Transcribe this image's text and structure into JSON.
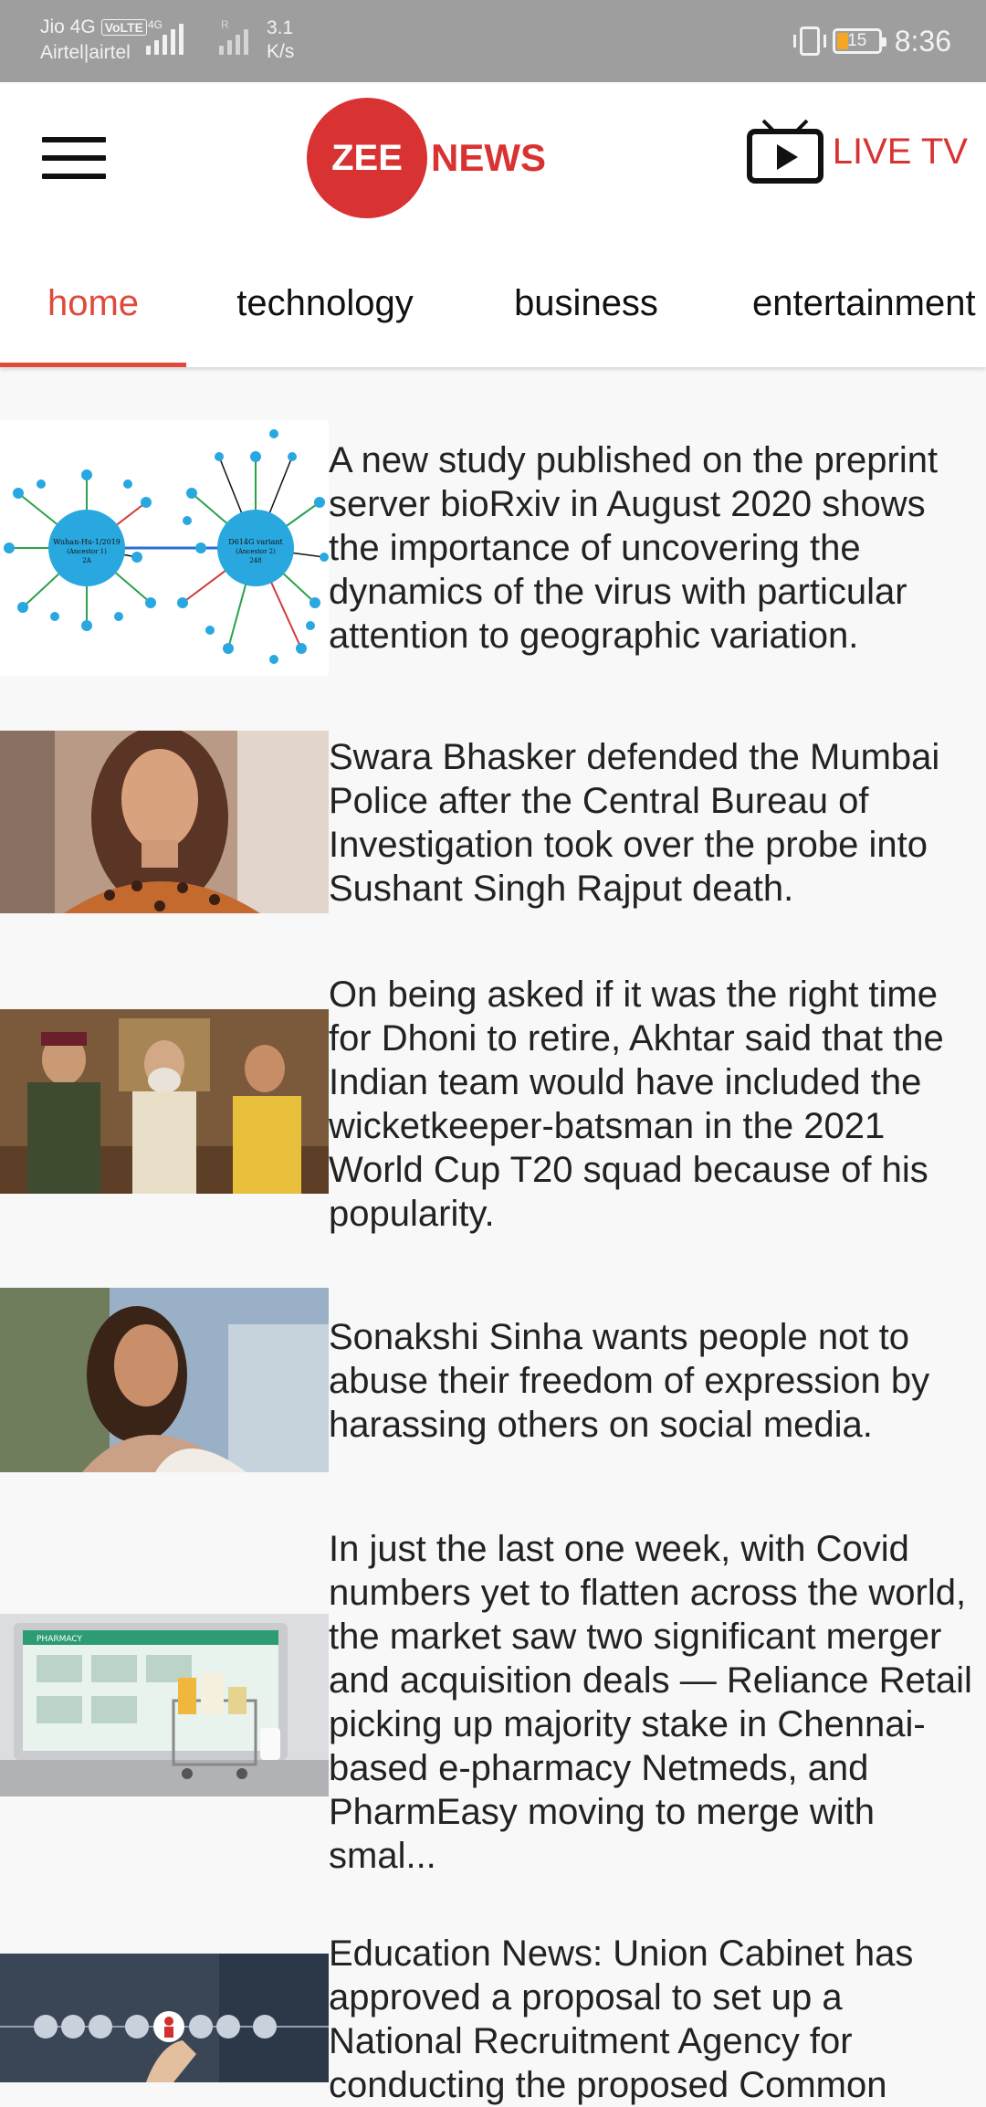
{
  "status_bar": {
    "carrier_line1": "Jio 4G",
    "volte": "VoLTE",
    "carrier_line2": "Airtel|airtel",
    "net_4g": "4G",
    "net_r": "R",
    "speed_value": "3.1",
    "speed_unit": "K/s",
    "battery_level": "15",
    "time": "8:36"
  },
  "header": {
    "logo_left": "ZEE",
    "logo_right": "NEWS",
    "live_tv_label": "LIVE TV",
    "accent_color": "#d93232"
  },
  "tabs": [
    {
      "label": "home",
      "active": true
    },
    {
      "label": "technology",
      "active": false
    },
    {
      "label": "business",
      "active": false
    },
    {
      "label": "entertainment",
      "active": false
    }
  ],
  "news": [
    {
      "headline": "A new study published on the preprint server bioRxiv in August 2020 shows the importance of uncovering the dynamics of the virus with particular attention to geographic variation.",
      "image": "virus-network-diagram",
      "diagram_labels": {
        "left": "Wuhan-Hu-1/2019",
        "left_sub": "(Ancestor 1)",
        "left_num": "2A",
        "right": "D614G variant",
        "right_sub": "(Ancestor 2)",
        "right_num": "248"
      }
    },
    {
      "headline": "Swara Bhasker defended the Mumbai Police after the Central Bureau of Investigation took over the probe into Sushant Singh Rajput death.",
      "image": "portrait-woman-polka-dot"
    },
    {
      "headline": "On being asked if it was the right time for Dhoni to retire, Akhtar said that the Indian team would have included the wicketkeeper-batsman in the 2021 World Cup T20 squad because of his popularity.",
      "image": "group-photo-three-people"
    },
    {
      "headline": "Sonakshi Sinha wants people not to abuse their freedom of expression by harassing others on social media.",
      "image": "portrait-woman-outdoor"
    },
    {
      "headline": "In just the last one week, with Covid numbers yet to flatten across the world, the market saw two significant merger and acquisition deals — Reliance Retail picking up majority stake in Chennai-based e-pharmacy Netmeds, and PharmEasy moving to merge with smal...",
      "image": "laptop-pharmacy-cart",
      "screen_label": "PHARMACY"
    },
    {
      "headline": "Education News:  Union Cabinet has approved a proposal to set up a National Recruitment Agency for conducting the proposed Common",
      "image": "recruitment-hand-icons"
    }
  ]
}
